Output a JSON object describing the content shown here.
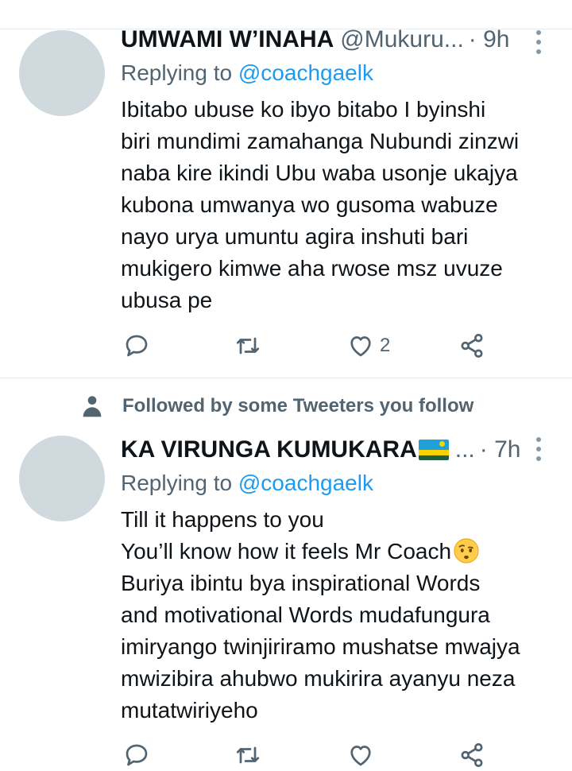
{
  "tweets": [
    {
      "name": "UMWAMI W’INAHA",
      "handle": "@Mukuru...",
      "time": "· 9h",
      "reply_prefix": "Replying to",
      "reply_to": "@coachgaelk",
      "lines": [
        "Ibitabo ubuse ko ibyo bitabo I byinshi",
        "biri mundimi zamahanga Nubundi zinzwi",
        "naba kire ikindi Ubu waba usonje ukajya",
        "kubona umwanya wo gusoma wabuze",
        "nayo urya umuntu agira inshuti bari",
        "mukigero kimwe aha rwose msz uvuze",
        "ubusa pe"
      ],
      "likes": "2"
    },
    {
      "social_context": "Followed by some Tweeters you follow",
      "name": "KA VIRUNGA KUMUKARA",
      "handle": "...",
      "time": "· 7h",
      "reply_prefix": "Replying to",
      "reply_to": "@coachgaelk",
      "lines": [
        "Till it happens to you",
        "You’ll know how it feels Mr Coach",
        "Buriya ibintu bya inspirational Words",
        "and motivational Words mudafungura",
        "imiryango twinjiriramo mushatse mwajya",
        "mwizibira ahubwo mukirira ayanyu neza",
        "mutatwiriyeho"
      ]
    }
  ],
  "colors": {
    "text": "#0f1419",
    "secondary": "#536471",
    "link": "#1d9bf0",
    "avatar": "#cfd9de",
    "divider": "#e6ecf0"
  },
  "icons": {
    "reply": "speech-bubble-icon",
    "retweet": "retweet-icon",
    "like": "heart-icon",
    "share": "share-icon",
    "more": "vertical-dots-icon",
    "social": "person-icon",
    "flag": "rwanda-flag-emoji",
    "face": "face-with-raised-eyebrow-emoji"
  }
}
